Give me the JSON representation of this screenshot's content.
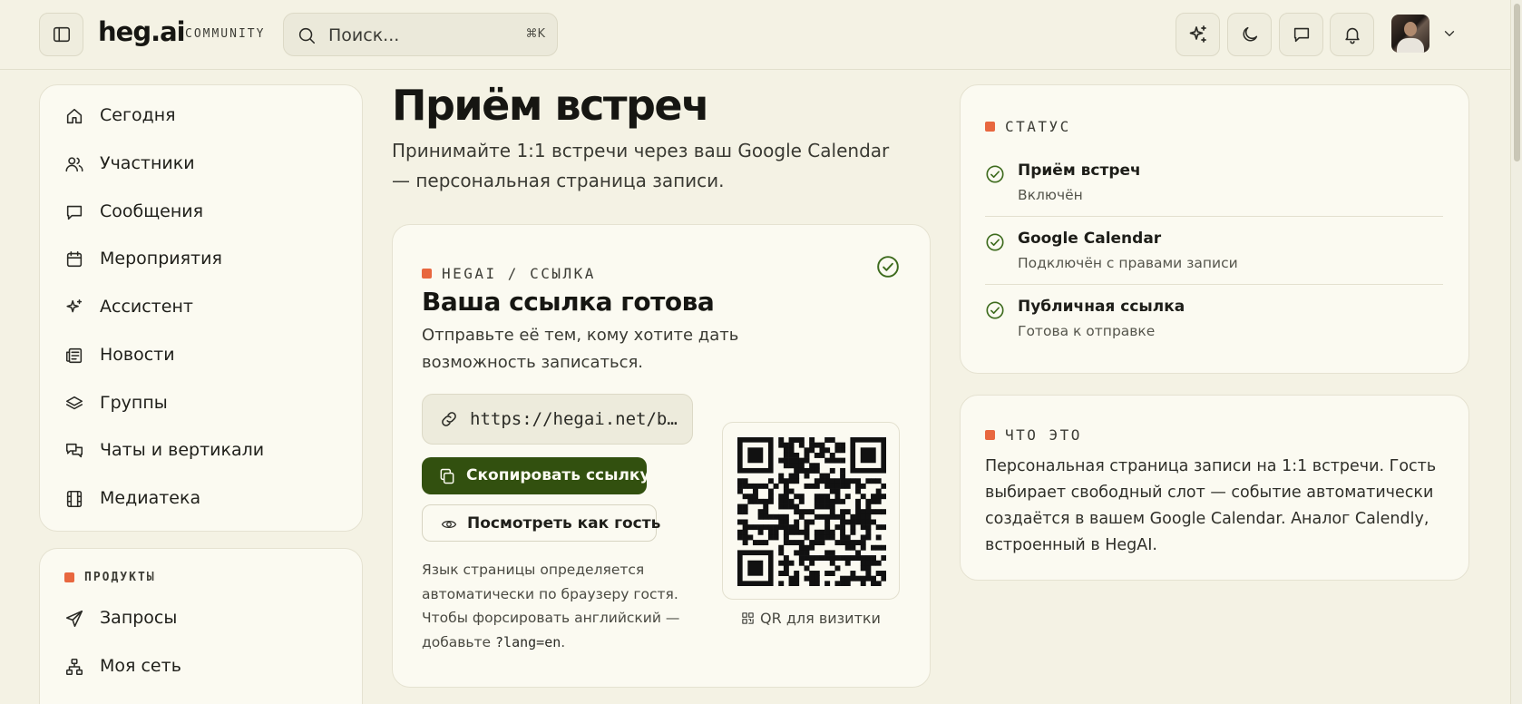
{
  "header": {
    "logo": "heg.ai",
    "logo_tag": "COMMUNITY",
    "search_placeholder": "Поиск...",
    "search_shortcut": "⌘K",
    "icons": [
      "sidebar-toggle-icon",
      "sparkles-icon",
      "moon-icon",
      "chat-icon",
      "bell-icon",
      "chevron-down-icon"
    ]
  },
  "sidebar": {
    "items": [
      {
        "label": "Сегодня",
        "icon": "home-icon"
      },
      {
        "label": "Участники",
        "icon": "users-icon"
      },
      {
        "label": "Сообщения",
        "icon": "message-icon"
      },
      {
        "label": "Мероприятия",
        "icon": "calendar-icon"
      },
      {
        "label": "Ассистент",
        "icon": "sparkles-icon"
      },
      {
        "label": "Новости",
        "icon": "newspaper-icon"
      },
      {
        "label": "Группы",
        "icon": "layers-icon"
      },
      {
        "label": "Чаты и вертикали",
        "icon": "chats-icon"
      },
      {
        "label": "Медиатека",
        "icon": "film-icon"
      }
    ],
    "products_title": "ПРОДУКТЫ",
    "products": [
      {
        "label": "Запросы",
        "icon": "send-icon"
      },
      {
        "label": "Моя сеть",
        "icon": "network-icon"
      }
    ]
  },
  "main": {
    "title": "Приём встреч",
    "subtitle": "Принимайте 1:1 встречи через ваш Google Calendar — персональная страница записи.",
    "link_card": {
      "eyebrow": "HEGAI / ССЫЛКА",
      "title": "Ваша ссылка готова",
      "description": "Отправьте её тем, кому хотите дать возможность записаться.",
      "url": "https://hegai.net/b…",
      "copy_label": "Скопировать ссылку",
      "guest_label": "Посмотреть как гость",
      "note_text": "Язык страницы определяется автоматически по браузеру гостя. Чтобы форсировать английский — добавьте ",
      "note_code": "?lang=en",
      "note_end": ".",
      "qr_caption": "QR для визитки"
    }
  },
  "status_card": {
    "title": "СТАТУС",
    "items": [
      {
        "title": "Приём встреч",
        "subtitle": "Включён"
      },
      {
        "title": "Google Calendar",
        "subtitle": "Подключён с правами записи"
      },
      {
        "title": "Публичная ссылка",
        "subtitle": "Готова к отправке"
      }
    ]
  },
  "about_card": {
    "title": "ЧТО ЭТО",
    "text": "Персональная страница записи на 1:1 встречи. Гость выбирает свободный слот — событие автоматически создаётся в вашем Google Calendar. Аналог Calendly, встроенный в HegAI."
  },
  "colors": {
    "background": "#f4f2e4",
    "card": "#fbfaf1",
    "accent_green": "#32500f",
    "accent_orange": "#e8673f",
    "check_green": "#3d6b1d"
  }
}
